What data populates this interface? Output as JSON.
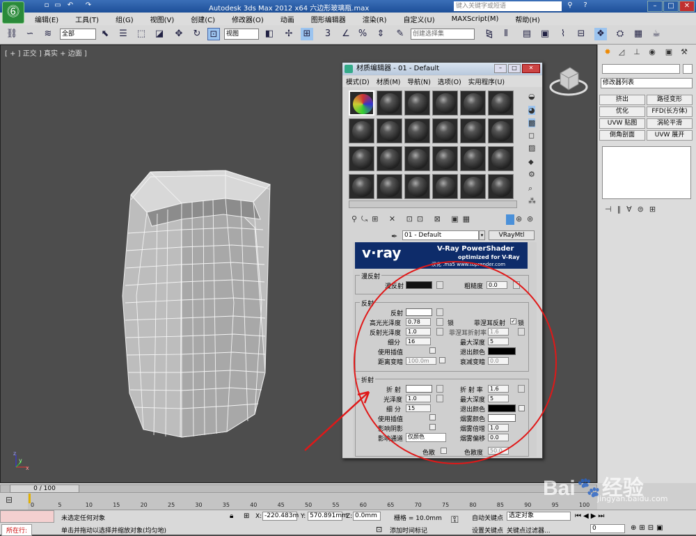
{
  "window": {
    "title": "Autodesk 3ds Max  2012 x64    六边形玻璃瓶.max",
    "search_placeholder": "键入关键字或短语"
  },
  "menubar": [
    "编辑(E)",
    "工具(T)",
    "组(G)",
    "视图(V)",
    "创建(C)",
    "修改器(O)",
    "动画",
    "图形编辑器",
    "渲染(R)",
    "自定义(U)",
    "MAXScript(M)",
    "帮助(H)"
  ],
  "toolbar": {
    "selection_filter": "全部",
    "coord_system": "视图",
    "named_selection": "创建选择集"
  },
  "viewport": {
    "label": "[ + ] 正交 ] 真实 + 边面 ]",
    "axis": {
      "x": "x",
      "y": "y",
      "z": "z"
    }
  },
  "material_editor": {
    "title": "材质编辑器 - 01 - Default",
    "menu": [
      "模式(D)",
      "材质(M)",
      "导航(N)",
      "选项(O)",
      "实用程序(U)"
    ],
    "material_name": "01 - Default",
    "material_type": "VRayMtl",
    "banner": {
      "brand": "v·ray",
      "title": "V-Ray PowerShader",
      "subtitle": "optimized for V-Ray",
      "credit": "汉化 .ma5 www.toprender.com"
    },
    "diffuse": {
      "group": "漫反射",
      "diffuse_label": "漫反射",
      "roughness_label": "粗糙度",
      "roughness": "0.0"
    },
    "reflection": {
      "group": "反射",
      "reflect_label": "反射",
      "hilight_label": "高光光泽度",
      "hilight": "0.78",
      "lock_label": "锁",
      "refl_gloss_label": "反射光泽度",
      "refl_gloss": "1.0",
      "subdiv_label": "细分",
      "subdiv": "16",
      "interp_label": "使用插值",
      "dim_label": "距离变暗",
      "dim_value": "100.0m",
      "fresnel_label": "菲涅耳反射",
      "fresnel_lock": "锁",
      "fresnel_ior_label": "菲涅耳折射率",
      "fresnel_ior": "1.6",
      "max_depth_label": "最大深度",
      "max_depth": "5",
      "exit_color_label": "退出颜色",
      "falloff_label": "衰减变暗",
      "falloff": "0.0"
    },
    "refraction": {
      "group": "折射",
      "refract_label": "折 射",
      "gloss_label": "光泽度",
      "gloss": "1.0",
      "subdiv_label": "细 分",
      "subdiv": "15",
      "interp_label": "使用插值",
      "shadow_label": "影响阴影",
      "channel_label": "影响通道",
      "channel_value": "仅颜色",
      "ior_label": "折 射 率",
      "ior": "1.6",
      "max_depth_label": "最大深度",
      "max_depth": "5",
      "exit_color_label": "退出颜色",
      "fog_color_label": "烟雾颜色",
      "fog_mult_label": "烟雾倍增",
      "fog_mult": "1.0",
      "fog_bias_label": "烟雾偏移",
      "fog_bias": "0.0",
      "disp_label": "色散",
      "abbe_label": "色散度",
      "abbe": "50.0"
    }
  },
  "command_panel": {
    "modifier_list": "修改器列表",
    "buttons": [
      "挤出",
      "路径变形",
      "优化",
      "FFD(长方体)",
      "UVW 贴图",
      "涡轮平滑",
      "倒角剖面",
      "UVW 展开"
    ]
  },
  "timeline": {
    "frame": "0 / 100",
    "ticks": [
      "0",
      "5",
      "10",
      "15",
      "20",
      "25",
      "30",
      "35",
      "40",
      "45",
      "50",
      "55",
      "60",
      "65",
      "70",
      "75",
      "80",
      "85",
      "90",
      "95",
      "100"
    ]
  },
  "status": {
    "running": "所在行:",
    "selection": "未选定任何对象",
    "hint": "单击并拖动以选择并缩放对象(均匀地)",
    "x_label": "X:",
    "x": "-220.483m",
    "y_label": "Y:",
    "y": "570.891mm",
    "z_label": "Z:",
    "z": "0.0mm",
    "grid": "栅格 = 10.0mm",
    "auto_key": "自动关键点",
    "selected": "选定对象",
    "set_key": "设置关键点",
    "key_filters": "关键点过滤器...",
    "add_time_tag": "添加时间标记",
    "frame_value": "0"
  },
  "watermark": {
    "brand": "Bai",
    "brand2": "经验",
    "url": "jingyan.baidu.com"
  }
}
